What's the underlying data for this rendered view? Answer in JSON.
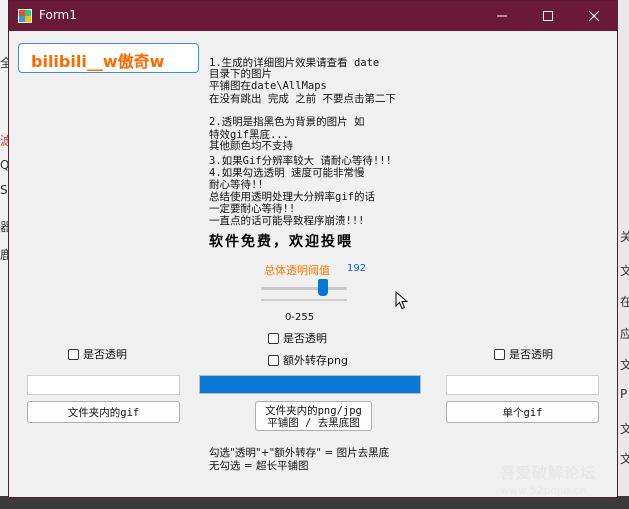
{
  "window": {
    "title": "Form1"
  },
  "brand": {
    "label": "bilibili__w傲奇w"
  },
  "notes": [
    "1.生成的详细图片效果请查看 date",
    "目录下的图片",
    "平铺图在date\\AllMaps",
    "在没有跳出 完成 之前 不要点击第二下",
    "",
    "2.透明是指黑色为背景的图片 如",
    "特效gif黑底...",
    "其他颜色均不支持",
    "3.如果Gif分辨率较大 请耐心等待!!!",
    "4.如果勾选透明 速度可能非常慢",
    "  耐心等待!!",
    "总结使用透明处理大分辨率gif的话",
    "一定要耐心等待!!",
    "一直点的话可能导致程序崩溃!!!"
  ],
  "ad": "软件免费，欢迎投喂",
  "threshold": {
    "label": "总体透明阈值",
    "value": "192",
    "fraction": 0.753,
    "range_label": "0-255"
  },
  "left_panel": {
    "transparent_label": "是否透明",
    "path_value": "",
    "button_label": "文件夹内的gif"
  },
  "center_panel": {
    "transparent_label": "是否透明",
    "extra_png_label": "额外转存png",
    "progress": 1.0,
    "button_label_line1": "文件夹内的png/jpg",
    "button_label_line2": "平铺图 /  去黑底图"
  },
  "right_panel": {
    "transparent_label": "是否透明",
    "path_value": "",
    "button_label": "单个gif"
  },
  "hint": {
    "line1": "勾选\"透明\"+\"额外转存\" = 图片去黑底",
    "line2": "无勾选 = 超长平铺图"
  },
  "watermark": {
    "line1": "吾爱破解论坛",
    "line2": "www.52pojie.cn"
  },
  "background": {
    "left_chars": [
      "全",
      "滤",
      "Q",
      "S",
      "器",
      "鹿"
    ],
    "right_chars": [
      "关",
      "文",
      "在",
      "应",
      "文",
      "P",
      "文",
      "文"
    ]
  },
  "colors": {
    "titlebar": "#6a1a37",
    "accent": "#0078d7",
    "brand": "#ff6a00",
    "threshold_label": "#ff7a00"
  }
}
